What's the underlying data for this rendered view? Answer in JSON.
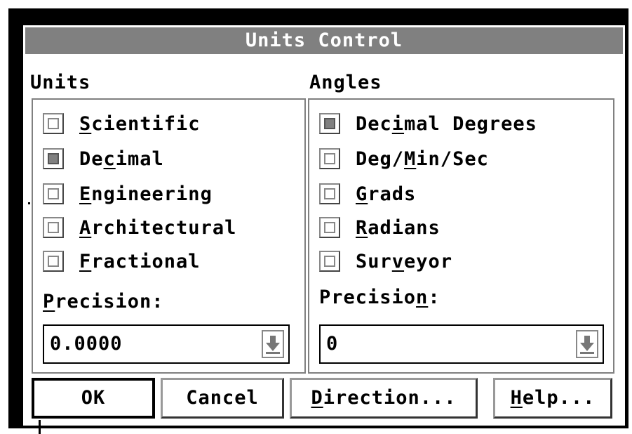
{
  "dialog": {
    "title": "Units Control"
  },
  "units": {
    "label": "Units",
    "options": [
      {
        "pre": "",
        "hot": "S",
        "post": "cientific",
        "checked": false
      },
      {
        "pre": "De",
        "hot": "c",
        "post": "imal",
        "checked": true
      },
      {
        "pre": "",
        "hot": "E",
        "post": "ngineering",
        "checked": false
      },
      {
        "pre": "",
        "hot": "A",
        "post": "rchitectural",
        "checked": false
      },
      {
        "pre": "",
        "hot": "F",
        "post": "ractional",
        "checked": false
      }
    ],
    "precision": {
      "pre": "",
      "hot": "P",
      "post": "recision:"
    },
    "precision_value": "0.0000"
  },
  "angles": {
    "label": "Angles",
    "options": [
      {
        "pre": "Dec",
        "hot": "i",
        "post": "mal Degrees",
        "checked": true
      },
      {
        "pre": "Deg/",
        "hot": "M",
        "post": "in/Sec",
        "checked": false
      },
      {
        "pre": "",
        "hot": "G",
        "post": "rads",
        "checked": false
      },
      {
        "pre": "",
        "hot": "R",
        "post": "adians",
        "checked": false
      },
      {
        "pre": "Sur",
        "hot": "v",
        "post": "eyor",
        "checked": false
      }
    ],
    "precision": {
      "pre": "Precisio",
      "hot": "n",
      "post": ":"
    },
    "precision_value": "0"
  },
  "buttons": {
    "ok": {
      "pre": "OK",
      "hot": "",
      "post": ""
    },
    "cancel": {
      "pre": "Cancel",
      "hot": "",
      "post": ""
    },
    "direction": {
      "pre": "",
      "hot": "D",
      "post": "irection..."
    },
    "help": {
      "pre": "",
      "hot": "H",
      "post": "elp..."
    }
  }
}
